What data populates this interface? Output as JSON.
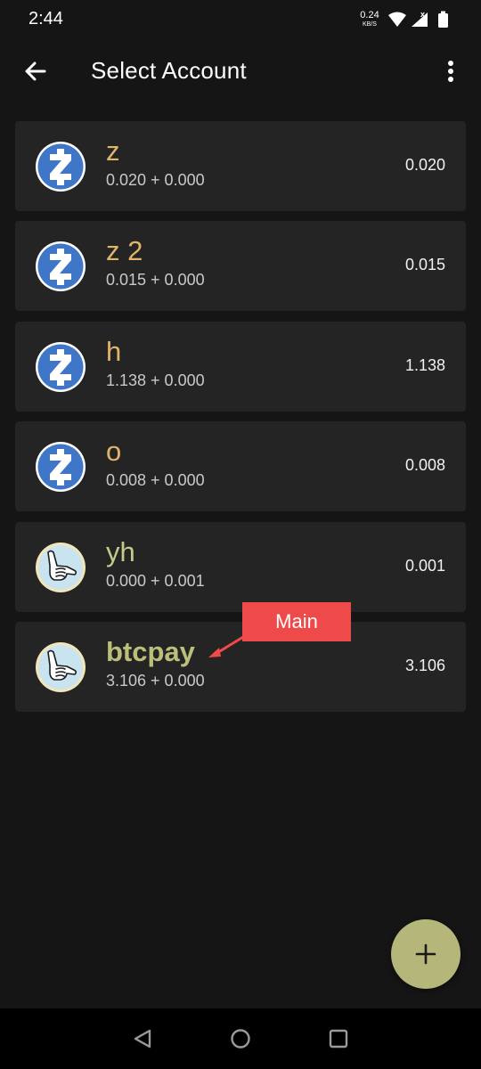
{
  "status_bar": {
    "time": "2:44",
    "net_speed": "0.24",
    "net_unit": "KB/S"
  },
  "header": {
    "title": "Select Account"
  },
  "accounts": [
    {
      "name": "z",
      "sub": "0.020 + 0.000",
      "balance": "0.020",
      "icon": "zcash-icon"
    },
    {
      "name": "z 2",
      "sub": "0.015 + 0.000",
      "balance": "0.015",
      "icon": "zcash-icon"
    },
    {
      "name": "h",
      "sub": "1.138 + 0.000",
      "balance": "1.138",
      "icon": "zcash-icon"
    },
    {
      "name": "o",
      "sub": "0.008 + 0.000",
      "balance": "0.008",
      "icon": "zcash-icon"
    },
    {
      "name": "yh",
      "sub": "0.000 + 0.001",
      "balance": "0.001",
      "icon": "shaka-hand-icon"
    },
    {
      "name": "btcpay",
      "sub": "3.106 + 0.000",
      "balance": "3.106",
      "icon": "shaka-hand-icon"
    }
  ],
  "callout": {
    "label": "Main"
  },
  "colors": {
    "background": "#151515",
    "card": "#242424",
    "account_name": "#e0b569",
    "fab": "#b4b67a",
    "zcash_blue": "#3f76c8",
    "callout": "#ee4a4a"
  }
}
